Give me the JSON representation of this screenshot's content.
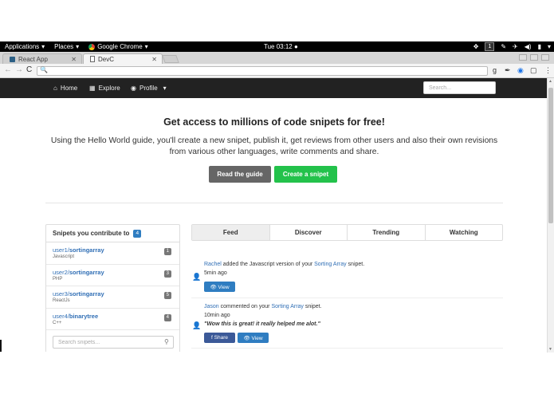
{
  "gnome": {
    "applications": "Applications",
    "places": "Places",
    "app_name": "Google Chrome",
    "clock": "Tue 03:12",
    "workspace": "1"
  },
  "browser": {
    "tabs": [
      {
        "label": "React App",
        "active": false
      },
      {
        "label": "DevC",
        "active": true
      }
    ],
    "ext_g": "g"
  },
  "site_nav": {
    "home": "Home",
    "explore": "Explore",
    "profile": "Profile",
    "search_placeholder": "Search..."
  },
  "hero": {
    "title": "Get access to millions of code snipets for free!",
    "text": "Using the Hello World guide, you'll create a new snipet, publish it, get reviews from other users and also their own revisions from various other languages, write comments and share.",
    "btn_guide": "Read the guide",
    "btn_create": "Create a snipet"
  },
  "sidebar": {
    "title": "Snipets you contribute to",
    "count": "4",
    "items": [
      {
        "user": "user1",
        "name": "sortingarray",
        "lang": "Javascript",
        "count": "1"
      },
      {
        "user": "user2",
        "name": "sortingarray",
        "lang": "PHP",
        "count": "3"
      },
      {
        "user": "user3",
        "name": "sortingarray",
        "lang": "ReactJs",
        "count": "5"
      },
      {
        "user": "user4",
        "name": "binarytree",
        "lang": "C++",
        "count": "4"
      }
    ],
    "search_placeholder": "Search snipets..."
  },
  "feed": {
    "tabs": [
      "Feed",
      "Discover",
      "Trending",
      "Watching"
    ],
    "items": [
      {
        "user": "Rachel",
        "action": " added the Javascript version of your ",
        "target": "Sorting Array",
        "suffix": " snipet.",
        "time": "5min ago",
        "view": "View"
      },
      {
        "user": "Jason",
        "action": " commented on your ",
        "target": "Sorting Array",
        "suffix": " snipet.",
        "time": "10min ago",
        "quote": "\"Wow this is great! it really helped me alot.\"",
        "share": "Share",
        "view": "View"
      }
    ]
  },
  "colors": {
    "navbar": "#222222",
    "primary": "#2f7dc1",
    "success": "#23c24b",
    "link": "#2f6eb5",
    "facebook": "#3b5998"
  }
}
